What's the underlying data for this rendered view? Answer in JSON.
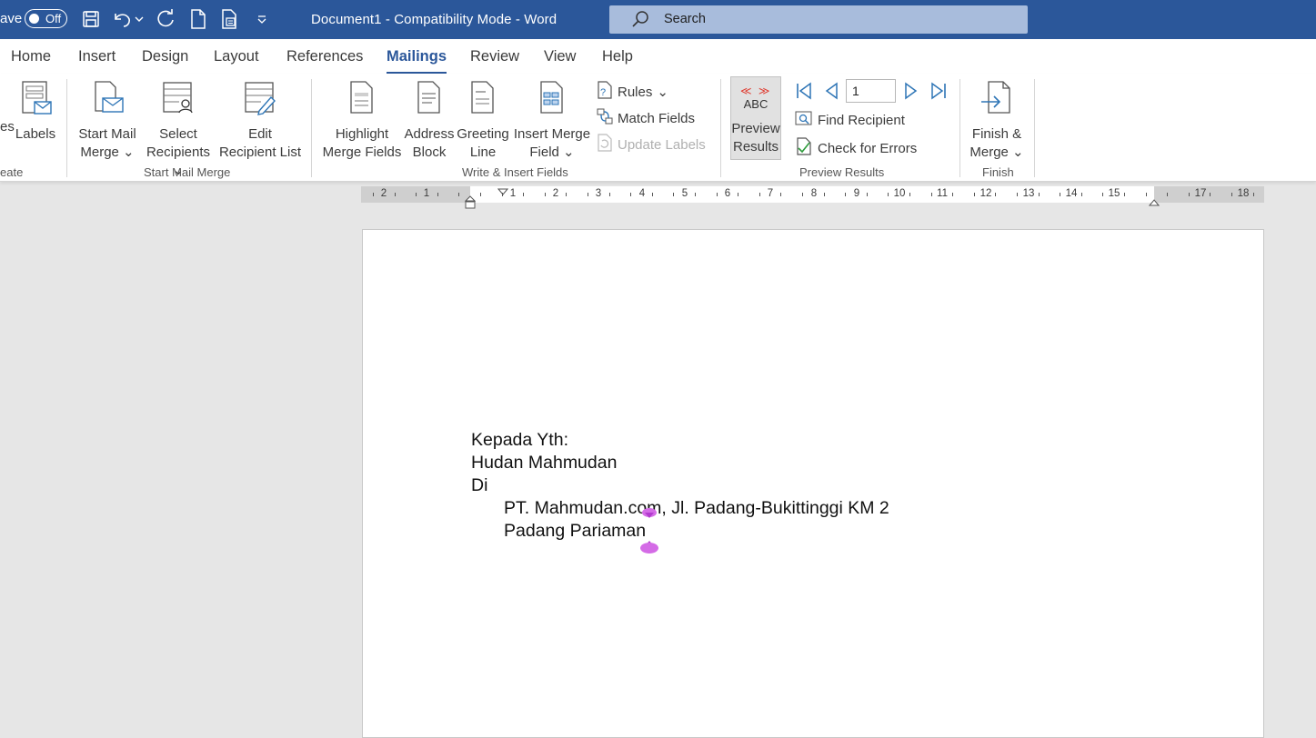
{
  "titlebar": {
    "autosave_label": "ave",
    "autosave_state": "Off",
    "document_title": "Document1  -  Compatibility Mode  -  Word",
    "search_placeholder": "Search",
    "color": "#2b579a"
  },
  "tabs": [
    "Home",
    "Insert",
    "Design",
    "Layout",
    "References",
    "Mailings",
    "Review",
    "View",
    "Help"
  ],
  "active_tab": "Mailings",
  "ribbon": {
    "create": {
      "partial_button": "es",
      "labels_button": "Labels",
      "group_label": "eate"
    },
    "start_mail_merge": {
      "start_mail_merge_line1": "Start Mail",
      "start_mail_merge_line2": "Merge",
      "select_recipients_line1": "Select",
      "select_recipients_line2": "Recipients",
      "edit_list_line1": "Edit",
      "edit_list_line2": "Recipient List",
      "group_label": "Start Mail Merge"
    },
    "write_insert": {
      "highlight_line1": "Highlight",
      "highlight_line2": "Merge Fields",
      "address_line1": "Address",
      "address_line2": "Block",
      "greeting_line1": "Greeting",
      "greeting_line2": "Line",
      "insert_field_line1": "Insert Merge",
      "insert_field_line2": "Field",
      "rules": "Rules",
      "match_fields": "Match Fields",
      "update_labels": "Update Labels",
      "group_label": "Write & Insert Fields"
    },
    "preview": {
      "abc": "ABC",
      "preview_line1": "Preview",
      "preview_line2": "Results",
      "record_number": "1",
      "find_recipient": "Find Recipient",
      "check_errors": "Check for Errors",
      "group_label": "Preview Results"
    },
    "finish": {
      "finish_line1": "Finish &",
      "finish_line2": "Merge",
      "group_label": "Finish"
    }
  },
  "ruler": {
    "left_numbers": [
      "2",
      "1"
    ],
    "right_numbers": [
      "1",
      "2",
      "3",
      "4",
      "5",
      "6",
      "7",
      "8",
      "9",
      "10",
      "11",
      "12",
      "13",
      "14",
      "15",
      "17",
      "18"
    ]
  },
  "document": {
    "lines": [
      "Kepada Yth:",
      "Hudan Mahmudan",
      "Di",
      "PT. Mahmudan.com, Jl. Padang-Bukittinggi KM 2",
      "Padang Pariaman"
    ]
  }
}
